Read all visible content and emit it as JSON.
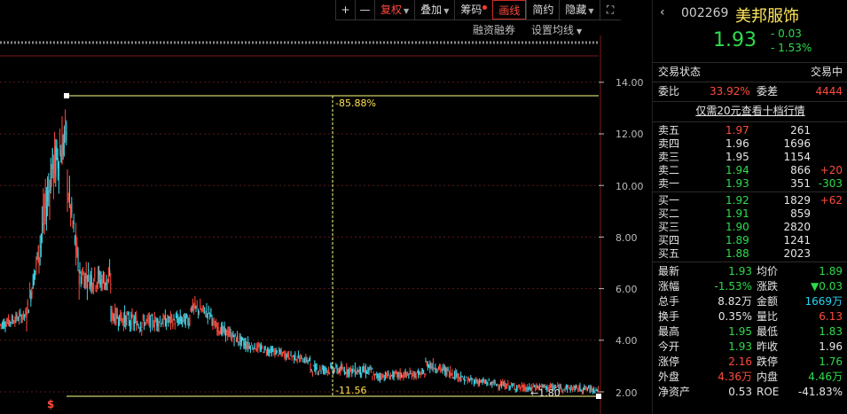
{
  "toolbar": {
    "plus": "+",
    "minus": "—",
    "fuquan": "复权",
    "diejia": "叠加",
    "chouma": "筹码",
    "huaxian": "画线",
    "jianyue": "简约",
    "yincang": "隐藏"
  },
  "subtoolbar": {
    "margin": "融资融券",
    "ma_settings": "设置均线"
  },
  "axis": {
    "labels": [
      "14.00",
      "12.00",
      "10.00",
      "8.00",
      "6.00",
      "4.00",
      "2.00"
    ]
  },
  "annotations": {
    "percent": "85.88%",
    "low_value": "11.56",
    "recent_low": "1.80",
    "marker": "$"
  },
  "stock": {
    "code": "002269",
    "name": "美邦服饰",
    "price": "1.93",
    "change": "- 0.03",
    "change_pct": "- 1.53%"
  },
  "status": {
    "label": "交易状态",
    "value": "交易中",
    "weibi_label": "委比",
    "weibi_value": "33.92%",
    "weicha_label": "委差",
    "weicha_value": "4444",
    "promo": "仅需20元查看十档行情"
  },
  "asks": [
    {
      "label": "卖五",
      "price": "1.97",
      "vol": "261",
      "delta": ""
    },
    {
      "label": "卖四",
      "price": "1.96",
      "vol": "1696",
      "delta": ""
    },
    {
      "label": "卖三",
      "price": "1.95",
      "vol": "1154",
      "delta": ""
    },
    {
      "label": "卖二",
      "price": "1.94",
      "vol": "866",
      "delta": "+20"
    },
    {
      "label": "卖一",
      "price": "1.93",
      "vol": "351",
      "delta": "-303"
    }
  ],
  "bids": [
    {
      "label": "买一",
      "price": "1.92",
      "vol": "1829",
      "delta": "+62"
    },
    {
      "label": "买二",
      "price": "1.91",
      "vol": "859",
      "delta": ""
    },
    {
      "label": "买三",
      "price": "1.90",
      "vol": "2820",
      "delta": ""
    },
    {
      "label": "买四",
      "price": "1.89",
      "vol": "1241",
      "delta": ""
    },
    {
      "label": "买五",
      "price": "1.88",
      "vol": "2023",
      "delta": ""
    }
  ],
  "stats": [
    {
      "l1": "最新",
      "v1": "1.93",
      "l2": "均价",
      "v2": "1.89"
    },
    {
      "l1": "涨幅",
      "v1": "-1.53%",
      "l2": "涨跌",
      "v2": "▼0.03"
    },
    {
      "l1": "总手",
      "v1": "8.82万",
      "l2": "金额",
      "v2": "1669万"
    },
    {
      "l1": "换手",
      "v1": "0.35%",
      "l2": "量比",
      "v2": "6.13"
    },
    {
      "l1": "最高",
      "v1": "1.95",
      "l2": "最低",
      "v2": "1.83"
    },
    {
      "l1": "今开",
      "v1": "1.93",
      "l2": "昨收",
      "v2": "1.96"
    },
    {
      "l1": "涨停",
      "v1": "2.16",
      "l2": "跌停",
      "v2": "1.76"
    },
    {
      "l1": "外盘",
      "v1": "4.36万",
      "l2": "内盘",
      "v2": "4.46万"
    },
    {
      "l1": "净资产",
      "v1": "0.53",
      "l2": "ROE",
      "v2": "-41.83%"
    }
  ],
  "colors": {
    "up": "#ff4a3d",
    "down": "#2fdc4d",
    "candle_down": "#3fd6e8",
    "line": "#ffff88",
    "grid": "#5a1a1a"
  }
}
